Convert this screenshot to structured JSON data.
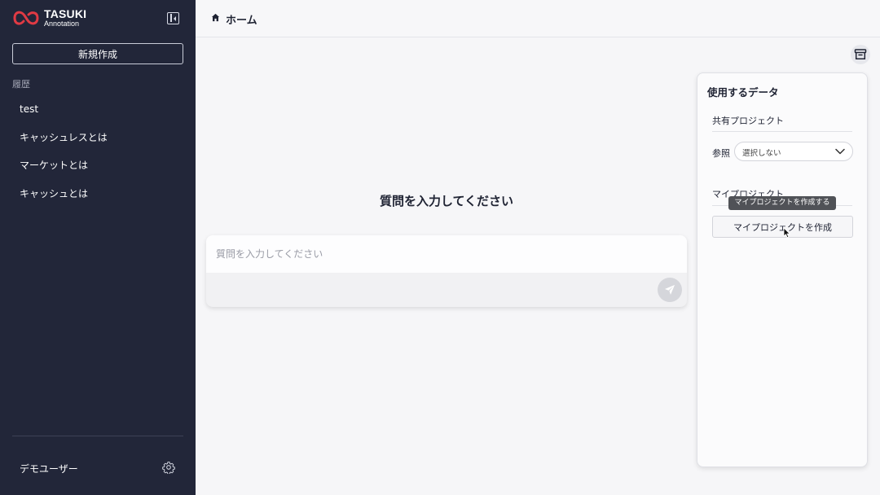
{
  "brand": {
    "title": "TASUKI",
    "subtitle": "Annotation",
    "accent": "#e03a44"
  },
  "sidebar": {
    "new_button_label": "新規作成",
    "history_label": "履歴",
    "history_items": [
      {
        "label": "test"
      },
      {
        "label": "キャッシュレスとは"
      },
      {
        "label": "マーケットとは"
      },
      {
        "label": "キャッシュとは"
      }
    ],
    "user_name": "デモユーザー",
    "background": "#222639"
  },
  "header": {
    "title": "ホーム",
    "icon": "home-icon"
  },
  "main": {
    "heading": "質問を入力してください",
    "input_placeholder": "質問を入力してください",
    "input_value": ""
  },
  "panel": {
    "title": "使用するデータ",
    "shared_project_label": "共有プロジェクト",
    "reference_label": "参照",
    "reference_selected": "選択しない",
    "my_project_label": "マイプロジェクト",
    "create_button_label": "マイプロジェクトを作成",
    "tooltip": "マイプロジェクトを作成する"
  }
}
